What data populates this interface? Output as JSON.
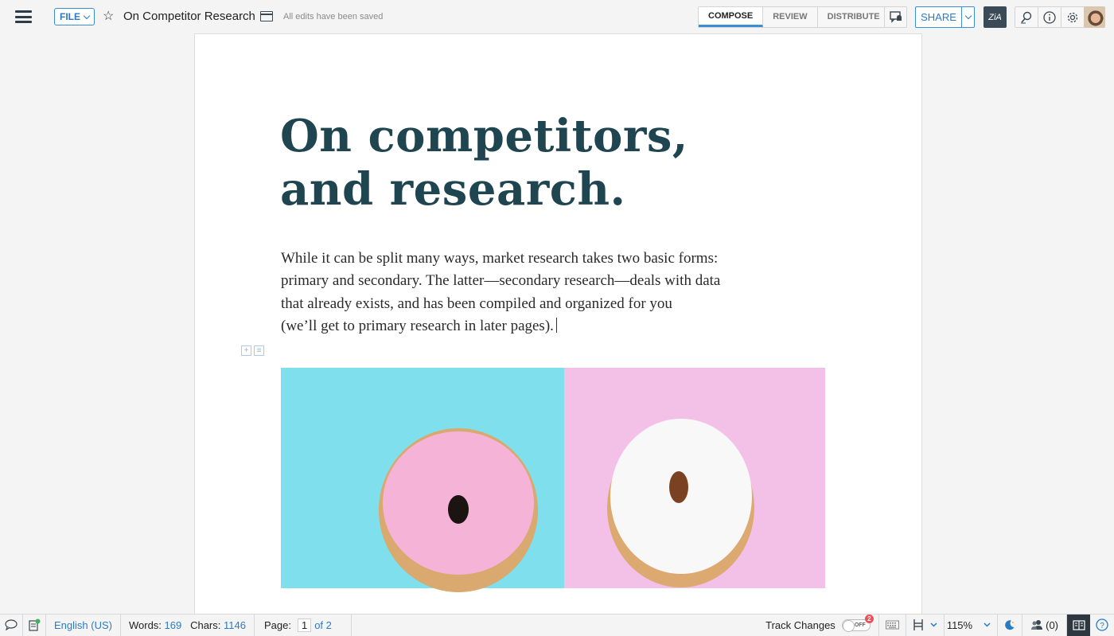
{
  "topbar": {
    "file_label": "FILE",
    "doc_title": "On Competitor Research",
    "save_status": "All edits have been saved",
    "mode_tabs": [
      {
        "label": "COMPOSE",
        "active": true
      },
      {
        "label": "REVIEW",
        "active": false
      },
      {
        "label": "DISTRIBUTE",
        "active": false
      }
    ],
    "share_label": "SHARE",
    "zia_label": "Zia",
    "icons": [
      "menu-icon",
      "star-icon",
      "folder-icon",
      "notify-icon",
      "search-icon",
      "info-icon",
      "gear-icon",
      "avatar"
    ]
  },
  "document": {
    "heading_lines": "On competitors,\nand research.",
    "paragraph_lines": [
      "While it can be split many ways, market research takes two basic forms:",
      "primary and secondary. The latter—secondary research—deals with data",
      "that already exists, and has been compiled and organized for you",
      "(we’ll get to primary research in later pages)."
    ],
    "image": {
      "description": "Two donuts: pink-frosted donut on blue background, white-frosted donut with sprinkles on pink background",
      "left_bg": "#7fdfec",
      "right_bg": "#f3c0e8"
    }
  },
  "statusbar": {
    "language": "English (US)",
    "words_label": "Words:",
    "words_value": "169",
    "chars_label": "Chars:",
    "chars_value": "1146",
    "page_label": "Page:",
    "page_current": "1",
    "page_total": "of 2",
    "track_changes_label": "Track Changes",
    "track_changes_state": "OFF",
    "track_changes_badge": "2",
    "zoom": "115%",
    "collaborators": "(0)"
  },
  "colors": {
    "accent": "#2b7bc4",
    "heading": "#1f4550",
    "zia_bg": "#3a4b57"
  }
}
